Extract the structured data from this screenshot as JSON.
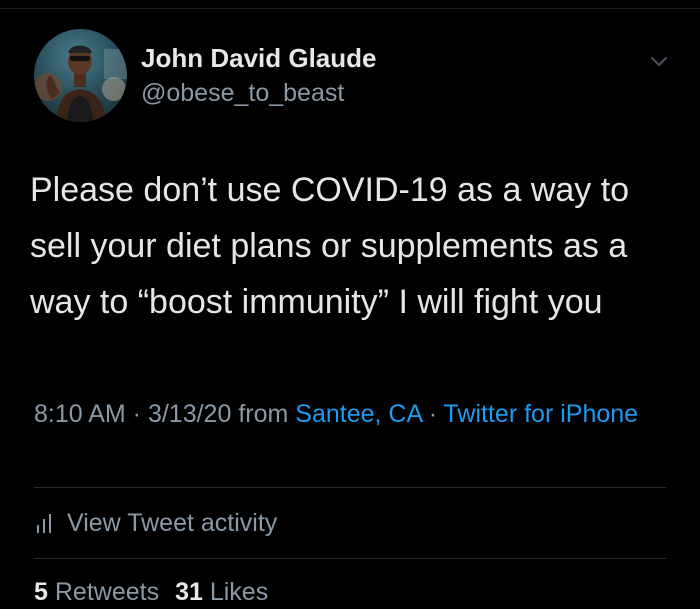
{
  "author": {
    "display_name": "John David Glaude",
    "handle": "@obese_to_beast"
  },
  "tweet": {
    "text": "Please don’t use COVID-19 as a way to sell your diet plans or supplements as a way to “boost immunity” I will fight you"
  },
  "meta": {
    "time": "8:10 AM",
    "sep1": " · ",
    "date": "3/13/20",
    "from_label": " from ",
    "location": "Santee, CA",
    "sep2": " · ",
    "client": "Twitter for iPhone"
  },
  "activity": {
    "label": "View Tweet activity"
  },
  "stats": {
    "retweets_count": "5",
    "retweets_label": "Retweets",
    "likes_count": "31",
    "likes_label": "Likes"
  },
  "icons": {
    "more": "chevron-down-icon",
    "activity": "bar-chart-icon"
  },
  "colors": {
    "background": "#000000",
    "link": "#1d9bf0",
    "secondary_text": "#8b98a5",
    "primary_text": "#e6e6e6"
  }
}
